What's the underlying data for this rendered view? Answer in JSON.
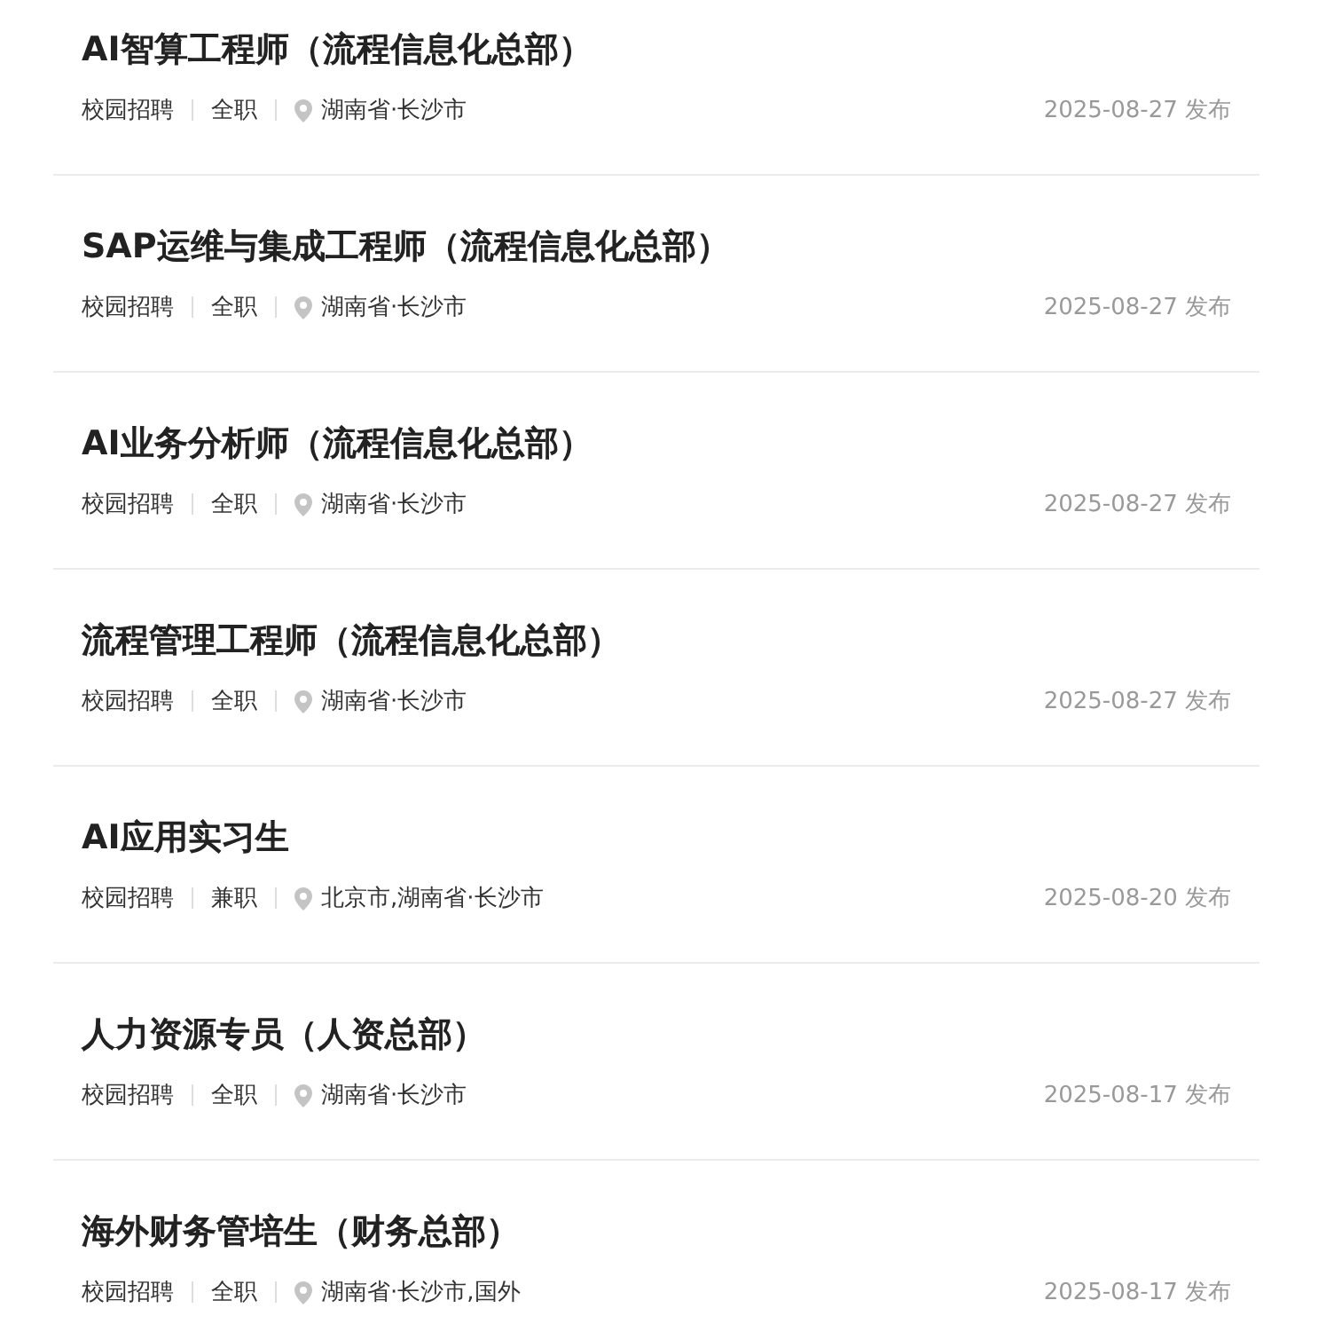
{
  "jobs": [
    {
      "title": "AI智算工程师（流程信息化总部）",
      "category": "校园招聘",
      "type": "全职",
      "location": "湖南省·长沙市",
      "date": "2025-08-27 发布"
    },
    {
      "title": "SAP运维与集成工程师（流程信息化总部）",
      "category": "校园招聘",
      "type": "全职",
      "location": "湖南省·长沙市",
      "date": "2025-08-27 发布"
    },
    {
      "title": "AI业务分析师（流程信息化总部）",
      "category": "校园招聘",
      "type": "全职",
      "location": "湖南省·长沙市",
      "date": "2025-08-27 发布"
    },
    {
      "title": "流程管理工程师（流程信息化总部）",
      "category": "校园招聘",
      "type": "全职",
      "location": "湖南省·长沙市",
      "date": "2025-08-27 发布"
    },
    {
      "title": "AI应用实习生",
      "category": "校园招聘",
      "type": "兼职",
      "location": "北京市,湖南省·长沙市",
      "date": "2025-08-20 发布"
    },
    {
      "title": "人力资源专员（人资总部）",
      "category": "校园招聘",
      "type": "全职",
      "location": "湖南省·长沙市",
      "date": "2025-08-17 发布"
    },
    {
      "title": "海外财务管培生（财务总部）",
      "category": "校园招聘",
      "type": "全职",
      "location": "湖南省·长沙市,国外",
      "date": "2025-08-17 发布"
    }
  ]
}
